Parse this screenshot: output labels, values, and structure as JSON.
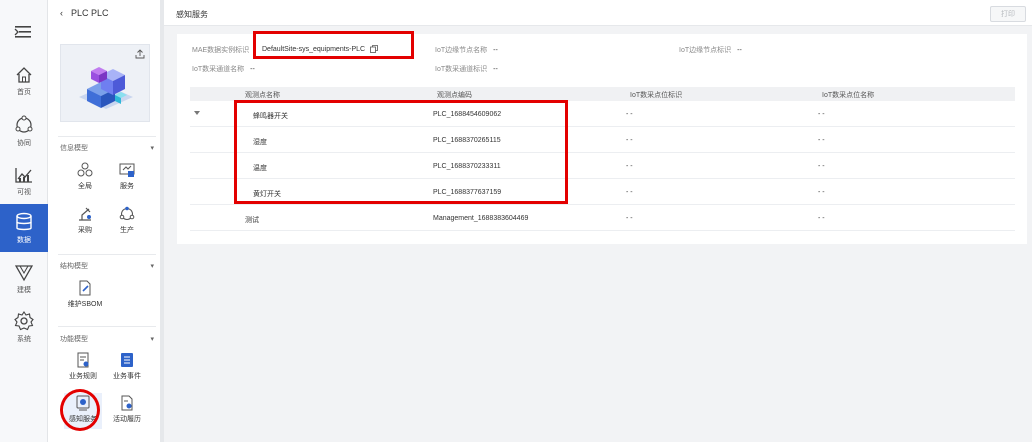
{
  "rail": {
    "items": [
      {
        "label": "首页",
        "icon": "home-icon"
      },
      {
        "label": "协同",
        "icon": "collaboration-icon"
      },
      {
        "label": "可视",
        "icon": "chart-icon"
      },
      {
        "label": "数据",
        "icon": "database-icon"
      },
      {
        "label": "建模",
        "icon": "modeling-icon"
      },
      {
        "label": "系统",
        "icon": "settings-icon"
      }
    ]
  },
  "subnav": {
    "back_label": "PLC PLC",
    "groups": [
      {
        "title": "信息模型",
        "items": [
          {
            "label": "全局"
          },
          {
            "label": "服务"
          },
          {
            "label": "采购"
          },
          {
            "label": "生产"
          }
        ]
      },
      {
        "title": "结构模型",
        "items": [
          {
            "label": "维护SBOM"
          }
        ]
      },
      {
        "title": "功能模型",
        "items": [
          {
            "label": "业务规则"
          },
          {
            "label": "业务事件"
          },
          {
            "label": "感知服务"
          },
          {
            "label": "活动履历"
          }
        ]
      }
    ]
  },
  "header": {
    "title": "感知服务",
    "print_label": "打印"
  },
  "meta": {
    "mae_label": "MAE数据实例标识",
    "mae_value": "DefaultSite-sys_equipments-PLC",
    "edge_name_label": "IoT边缘节点名称",
    "edge_name_value": "--",
    "edge_id_label": "IoT边缘节点标识",
    "edge_id_value": "--",
    "channel_name_label": "IoT数采通道名称",
    "channel_name_value": "--",
    "channel_id_label": "IoT数采通道标识",
    "channel_id_value": "--"
  },
  "table": {
    "columns": [
      "观测点名称",
      "观测点编码",
      "IoT数采点位标识",
      "IoT数采点位名称"
    ],
    "rows": [
      [
        "蜂鸣器开关",
        "PLC_1688454609062",
        "- -",
        "- -"
      ],
      [
        "湿度",
        "PLC_1688370265115",
        "- -",
        "- -"
      ],
      [
        "温度",
        "PLC_1688370233311",
        "- -",
        "- -"
      ],
      [
        "黄灯开关",
        "PLC_1688377637159",
        "- -",
        "- -"
      ],
      [
        "测试",
        "Management_1688383604469",
        "- -",
        "- -"
      ]
    ]
  },
  "colors": {
    "accent": "#2d62c9",
    "highlight": "#e30000"
  }
}
